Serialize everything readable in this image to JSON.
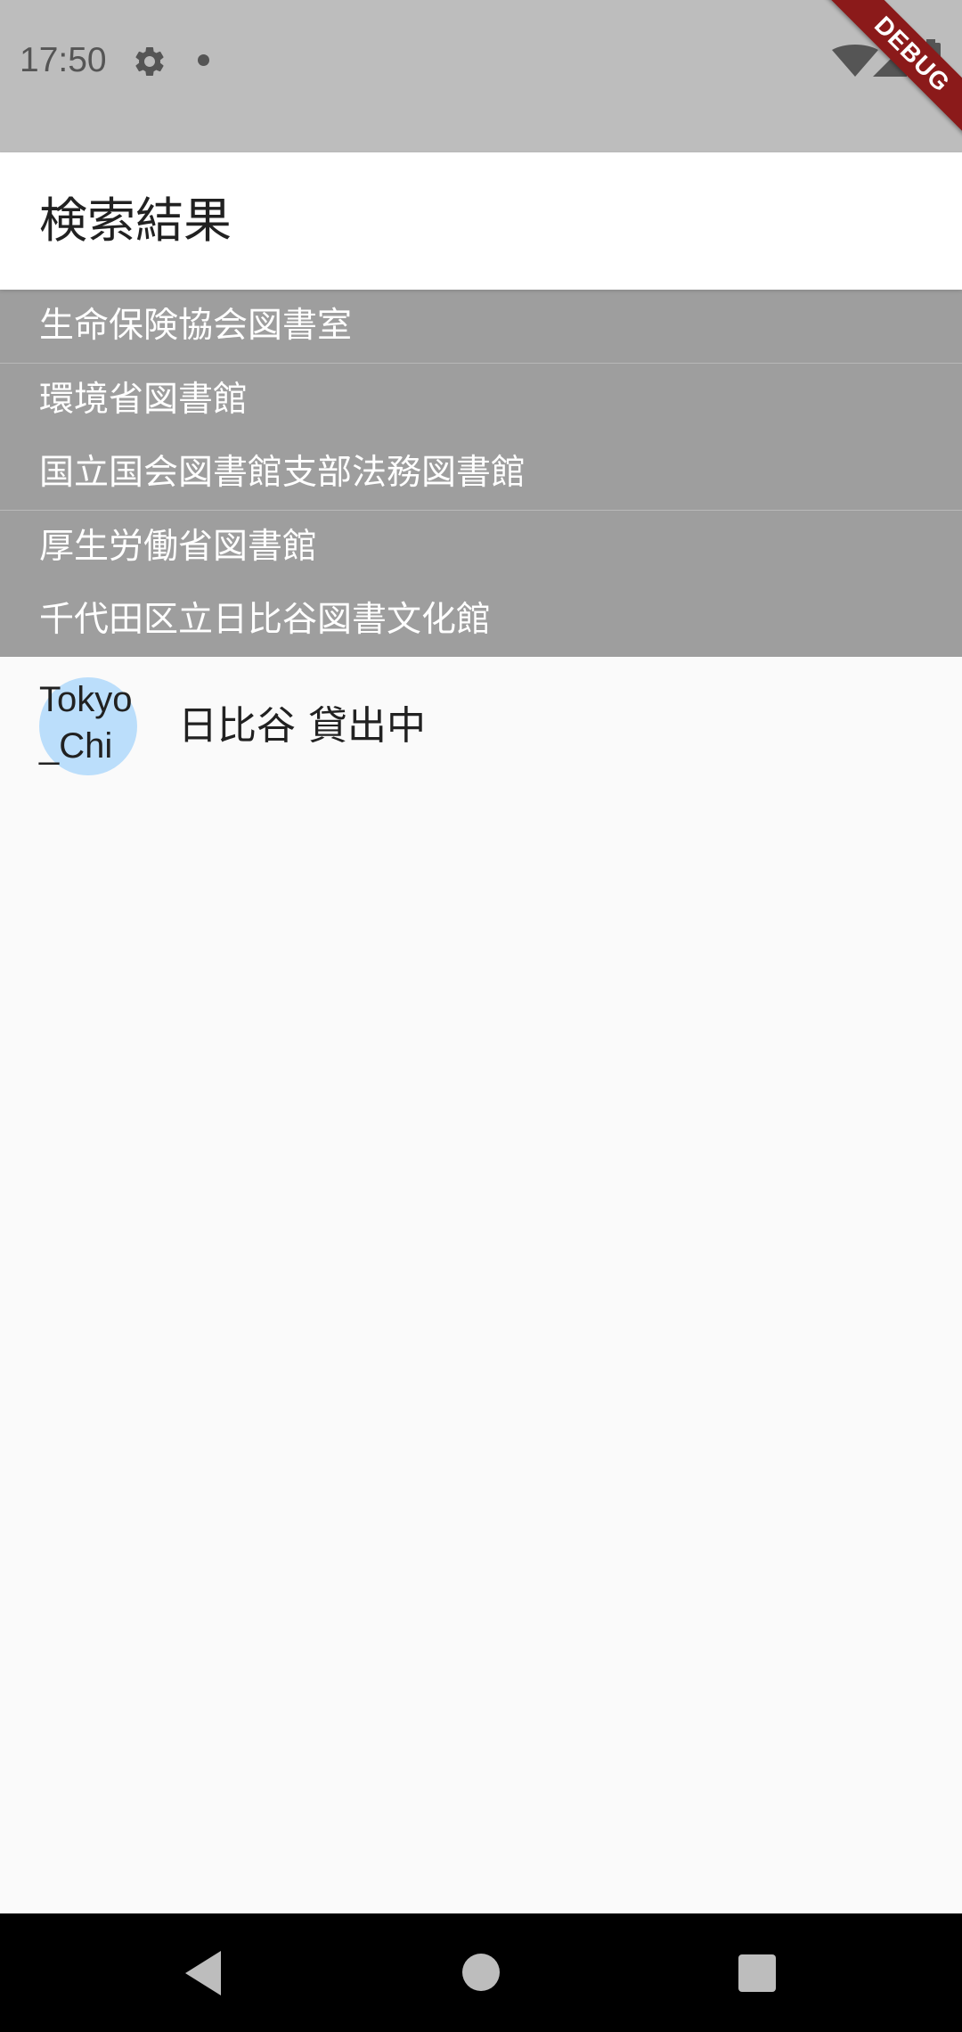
{
  "status_bar": {
    "time": "17:50",
    "icons": [
      "gear-icon",
      "notification-dot-icon",
      "wifi-icon",
      "signal-icon",
      "battery-icon"
    ]
  },
  "debug_banner": "DEBUG",
  "app_bar": {
    "title": "検索結果"
  },
  "results": [
    {
      "name": "生命保険協会図書室"
    },
    {
      "name": "環境省図書館"
    },
    {
      "name": "国立国会図書館支部法務図書館"
    },
    {
      "name": "厚生労働省図書館"
    },
    {
      "name": "千代田区立日比谷図書文化館"
    }
  ],
  "detail": {
    "avatar_text": "Tokyo_Chi",
    "status_text": "日比谷 貸出中"
  },
  "nav_bar": {
    "icons": [
      "back-icon",
      "home-icon",
      "recents-icon"
    ]
  },
  "colors": {
    "status_bar_bg": "#bdbdbd",
    "list_bg": "#9e9e9e",
    "avatar_bg": "#bbdefb",
    "debug_ribbon": "#8b1a1a"
  }
}
